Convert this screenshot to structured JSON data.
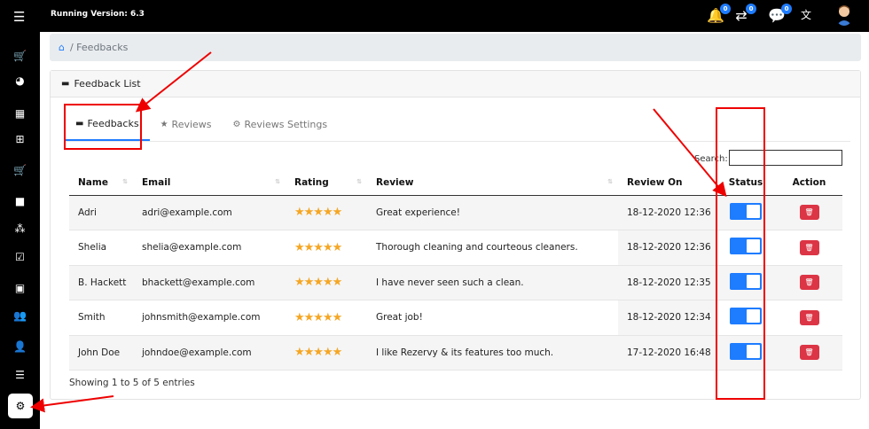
{
  "topbar": {
    "running_version": "Running Version: 6.3",
    "notifications_count": "0",
    "transfers_count": "0",
    "messages_count": "0"
  },
  "breadcrumb": {
    "current": "/ Feedbacks"
  },
  "card": {
    "title": "Feedback List"
  },
  "tabs": [
    {
      "label": "Feedbacks",
      "active": true
    },
    {
      "label": "Reviews",
      "active": false
    },
    {
      "label": "Reviews Settings",
      "active": false
    }
  ],
  "search": {
    "label": "Search:",
    "value": ""
  },
  "table": {
    "headers": [
      "Name",
      "Email",
      "Rating",
      "Review",
      "Review On",
      "Status",
      "Action"
    ],
    "rows": [
      {
        "name": "Adri",
        "email": "adri@example.com",
        "rating": 5,
        "stars": "★★★★★",
        "review": "Great experience!",
        "review_on": "18-12-2020 12:36",
        "status": "on"
      },
      {
        "name": "Shelia",
        "email": "shelia@example.com",
        "rating": 5,
        "stars": "★★★★★",
        "review": "Thorough cleaning and courteous cleaners.",
        "review_on": "18-12-2020 12:36",
        "status": "on"
      },
      {
        "name": "B. Hackett",
        "email": "bhackett@example.com",
        "rating": 5,
        "stars": "★★★★★",
        "review": "I have never seen such a clean.",
        "review_on": "18-12-2020 12:35",
        "status": "on"
      },
      {
        "name": "Smith",
        "email": "johnsmith@example.com",
        "rating": 5,
        "stars": "★★★★★",
        "review": "Great job!",
        "review_on": "18-12-2020 12:34",
        "status": "on"
      },
      {
        "name": "John Doe",
        "email": "johndoe@example.com",
        "rating": 5,
        "stars": "★★★★★",
        "review": "I like Rezervy & its features too much.",
        "review_on": "17-12-2020 16:48",
        "status": "on"
      }
    ]
  },
  "footer": {
    "showing": "Showing 1 to 5 of 5 entries"
  },
  "colors": {
    "accent": "#1e7cff",
    "danger": "#dc3545",
    "star": "#f5a623",
    "annotation": "#e00000"
  }
}
